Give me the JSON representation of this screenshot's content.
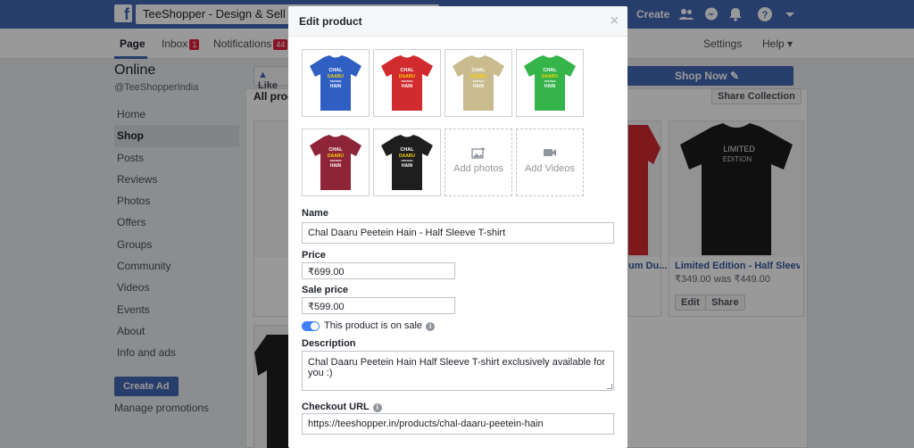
{
  "topbar": {
    "logo": "f",
    "search_value": "TeeShopper - Design & Sell Online",
    "create_label": "Create",
    "icons": [
      "friends-icon",
      "messenger-icon",
      "notifications-icon",
      "help-icon",
      "dropdown-icon"
    ]
  },
  "nav": {
    "page": "Page",
    "inbox": "Inbox",
    "inbox_count": "1",
    "notifications": "Notifications",
    "notifications_count": "44",
    "settings": "Settings",
    "help": "Help ▾"
  },
  "sidebar": {
    "page_name": "Online",
    "handle": "@TeeShopperIndia",
    "items": [
      {
        "label": "Home"
      },
      {
        "label": "Shop"
      },
      {
        "label": "Posts"
      },
      {
        "label": "Reviews"
      },
      {
        "label": "Photos"
      },
      {
        "label": "Offers"
      },
      {
        "label": "Groups"
      },
      {
        "label": "Community"
      },
      {
        "label": "Videos"
      },
      {
        "label": "Events"
      },
      {
        "label": "About"
      },
      {
        "label": "Info and ads"
      }
    ],
    "create_ad": "Create Ad",
    "manage_promotions": "Manage promotions"
  },
  "main": {
    "like_label": "Like",
    "shop_now": "Shop Now ✎",
    "all_products": "All produ",
    "share_collection": "Share Collection",
    "cards": [
      {
        "title": "um Du...",
        "price": ""
      },
      {
        "title": "Limited Edition - Half Sleeve T...",
        "price": "₹349.00 was ₹449.00",
        "edit": "Edit",
        "share": "Share",
        "image_text": "LIMITED EDITION"
      }
    ]
  },
  "modal": {
    "title": "Edit product",
    "close": "×",
    "photos": [
      {
        "color": "#2f5fc2"
      },
      {
        "color": "#d12b30"
      },
      {
        "color": "#c9bb8e"
      },
      {
        "color": "#35b44a"
      },
      {
        "color": "#8e2437"
      },
      {
        "color": "#1e1e1e"
      }
    ],
    "shirt_text": [
      "CHAL",
      "DAARU",
      "PEETEIN",
      "HAIN"
    ],
    "add_photos": "Add photos",
    "add_videos": "Add Videos",
    "name_label": "Name",
    "name_value": "Chal Daaru Peetein Hain - Half Sleeve T-shirt",
    "price_label": "Price",
    "price_value": "₹699.00",
    "sale_price_label": "Sale price",
    "sale_price_value": "₹599.00",
    "on_sale_label": "This product is on sale",
    "on_sale": true,
    "description_label": "Description",
    "description_value": "Chal Daaru Peetein Hain Half Sleeve T-shirt exclusively available for you :)",
    "checkout_label": "Checkout URL",
    "checkout_value": "https://teeshopper.in/products/chal-daaru-peetein-hain"
  },
  "colors": {
    "brand": "#4267b2",
    "link": "#365899",
    "badge": "#e41e3f",
    "toggle": "#4080ff"
  }
}
